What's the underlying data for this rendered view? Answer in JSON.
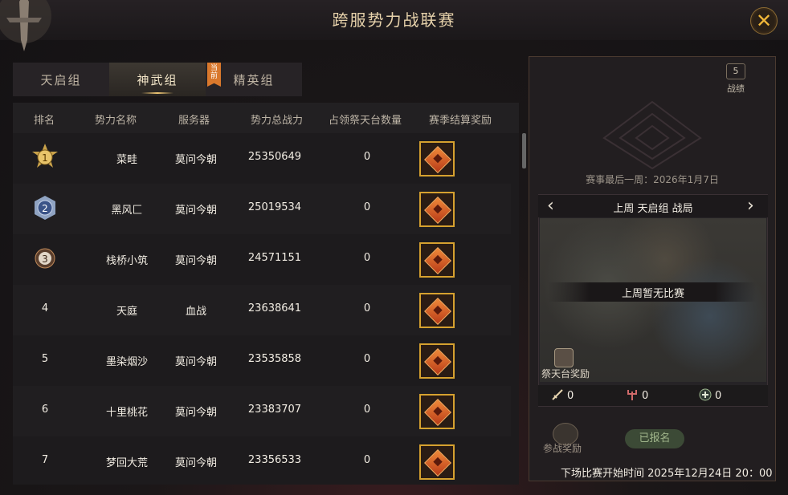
{
  "window": {
    "title": "跨服势力战联赛",
    "close_glyph": "✕"
  },
  "tabs": [
    {
      "label": "天启组",
      "active": false
    },
    {
      "label": "神武组",
      "active": true
    },
    {
      "label": "精英组",
      "active": false
    }
  ],
  "current_badge": "当前",
  "table": {
    "headers": [
      "排名",
      "势力名称",
      "服务器",
      "势力总战力",
      "占领祭天台数量",
      "赛季结算奖励"
    ],
    "rows": [
      {
        "rank": "1",
        "name": "菜畦",
        "server": "莫问今朝",
        "power": "25350649",
        "altars": "0"
      },
      {
        "rank": "2",
        "name": "黑风匚",
        "server": "莫问今朝",
        "power": "25019534",
        "altars": "0"
      },
      {
        "rank": "3",
        "name": "栈桥小筑",
        "server": "莫问今朝",
        "power": "24571151",
        "altars": "0"
      },
      {
        "rank": "4",
        "name": "天庭",
        "server": "血战",
        "power": "23638641",
        "altars": "0"
      },
      {
        "rank": "5",
        "name": "墨染烟沙",
        "server": "莫问今朝",
        "power": "23535858",
        "altars": "0"
      },
      {
        "rank": "6",
        "name": "十里桃花",
        "server": "莫问今朝",
        "power": "23383707",
        "altars": "0"
      },
      {
        "rank": "7",
        "name": "梦回大荒",
        "server": "莫问今朝",
        "power": "23356533",
        "altars": "0"
      }
    ]
  },
  "side": {
    "record_label": "战绩",
    "record_icon_glyph": "5",
    "last_week_date": "赛事最后一周：2026年1月7日",
    "map_title": "上周 天启组 战局",
    "prev_glyph": "‹",
    "next_glyph": "›",
    "no_match": "上周暂无比赛",
    "altar_reward_label": "祭天台奖励",
    "stats": [
      {
        "icon": "sword-icon",
        "value": "0"
      },
      {
        "icon": "trident-icon",
        "value": "0"
      },
      {
        "icon": "heal-icon",
        "value": "0"
      }
    ],
    "join_reward_label": "参战奖励",
    "signed_up_label": "已报名",
    "next_match": "下场比赛开始时间  2025年12月24日  20：00"
  },
  "colors": {
    "accent_gold": "#d6a12f",
    "close_yellow": "#f2b839",
    "badge_orange": "#d9782c",
    "signed_green": "#3c4a36"
  }
}
